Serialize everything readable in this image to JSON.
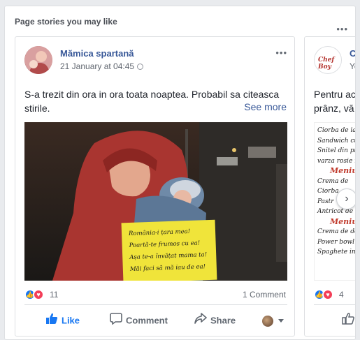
{
  "panel": {
    "title": "Page stories you may like",
    "more": "•••"
  },
  "post": {
    "page_name": "Mămica spartană",
    "timestamp": "21 January at 04:45",
    "more": "•••",
    "text": "S-a trezit din ora in ora toata noaptea. Probabil sa citeasca stirile.",
    "see_more": "See more",
    "photo_sign_lines": [
      "România-i țara mea!",
      "Poartă-te frumos cu ea!",
      "Așa te-a învățat mama ta!",
      "Măi faci să mă iau de ea!"
    ],
    "reaction_count": "11",
    "comment_count": "1 Comment",
    "actions": {
      "like": "Like",
      "comment": "Comment",
      "share": "Share"
    }
  },
  "next_post": {
    "page_name": "Cl",
    "timestamp": "Ye",
    "logo_text": "Chef Boy",
    "text_line1": "Pentru ac",
    "text_line2": "prânz, vă",
    "menu_lines": [
      "Ciorba de iar",
      "Sandwich cu",
      "Snitel din pie",
      "varza rosie m",
      "Meniu",
      "Crema de",
      "Ciorba",
      "Pastr",
      "Antricot de vi",
      "Meniu",
      "Crema de doc",
      "Power bowl c",
      "Spaghete inte"
    ],
    "reaction_count": "4"
  },
  "colors": {
    "like_blue": "#1877f2",
    "love_red": "#f33e58",
    "link": "#385898"
  }
}
